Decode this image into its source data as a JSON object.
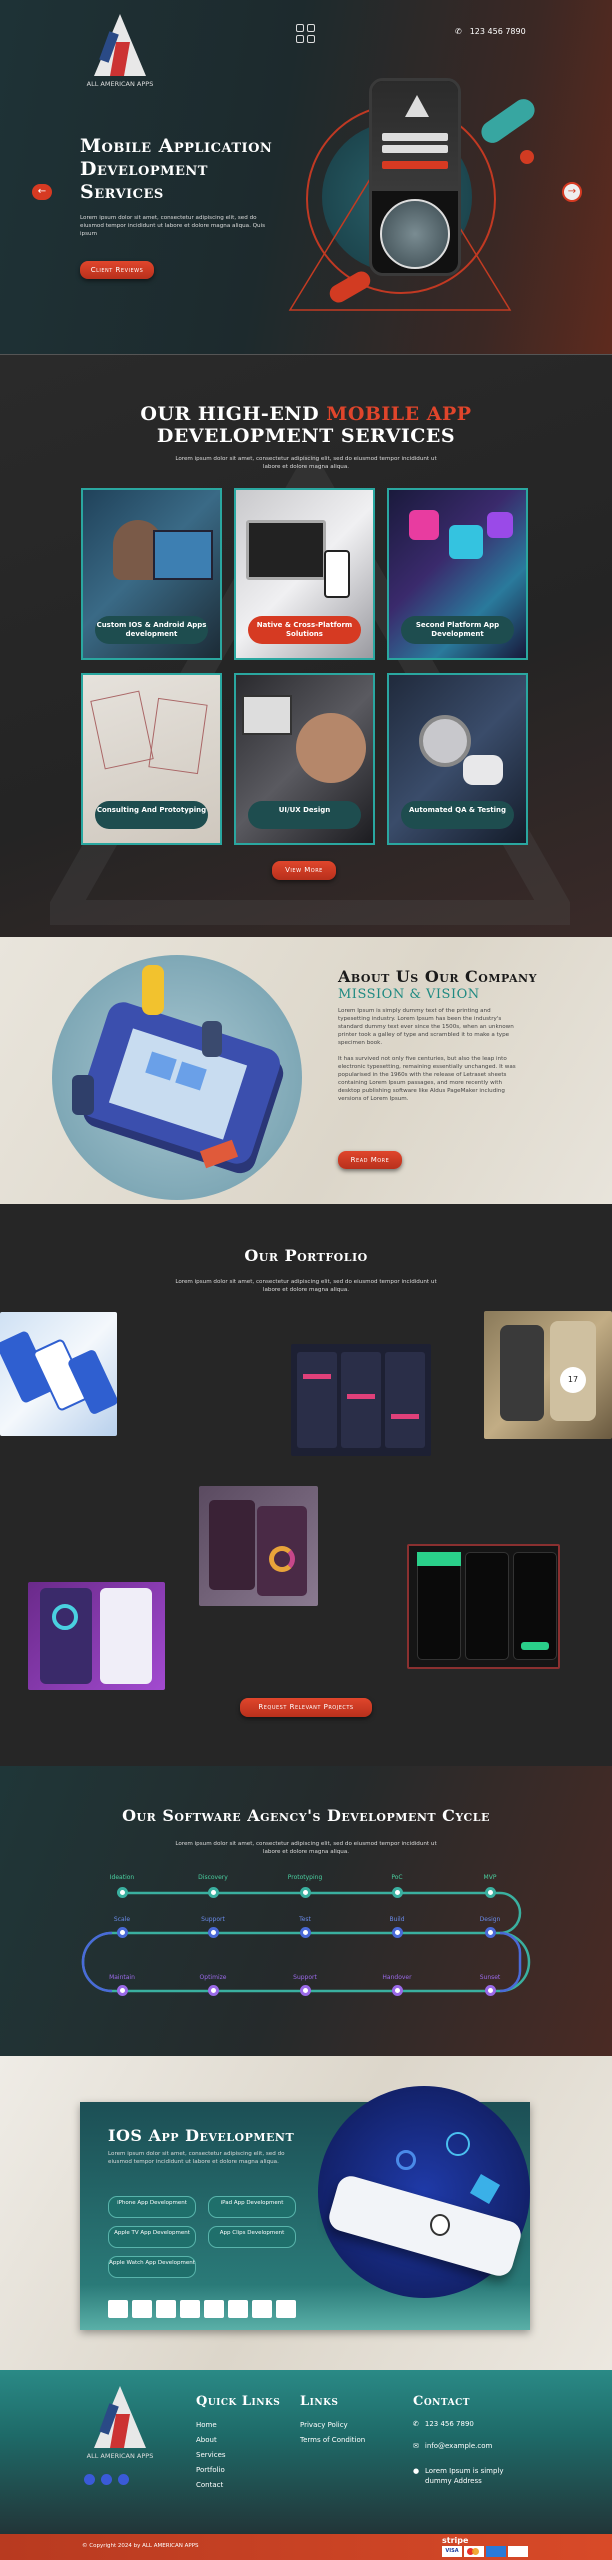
{
  "header": {
    "brand": "ALL AMERICAN APPS",
    "phone": "123 456 7890"
  },
  "hero": {
    "title_lines": [
      "Mobile Application",
      "Development",
      "Services"
    ],
    "text": "Lorem ipsum dolor sit amet, consectetur adipiscing elit, sed do eiusmod tempor incididunt ut labore et dolore magna aliqua. Quis ipsum",
    "cta": "Client Reviews"
  },
  "services": {
    "title_white": "OUR HIGH-END",
    "title_red": "MOBILE APP",
    "title_line2": "DEVELOPMENT SERVICES",
    "text": "Lorem ipsum dolor sit amet, consectetur adipiscing elit, sed do eiusmod tempor incididunt ut labore et dolore magna aliqua.",
    "cards": [
      {
        "label": "Custom IOS & Android Apps development"
      },
      {
        "label": "Native & Cross-Platform Solutions"
      },
      {
        "label": "Second Platform App Development"
      },
      {
        "label": "Consulting And Prototyping"
      },
      {
        "label": "UI/UX Design"
      },
      {
        "label": "Automated QA & Testing"
      }
    ],
    "cta": "View More"
  },
  "about": {
    "title": "About Us Our Company",
    "subtitle": "MISSION & VISION",
    "p1": "Lorem Ipsum is simply dummy text of the printing and typesetting industry. Lorem Ipsum has been the industry's standard dummy text ever since the 1500s, when an unknown printer took a galley of type and scrambled it to make a type specimen book.",
    "p2": "It has survived not only five centuries, but also the leap into electronic typesetting, remaining essentially unchanged. It was popularised in the 1960s with the release of Letraset sheets containing Lorem Ipsum passages, and more recently with desktop publishing software like Aldus PageMaker including versions of Lorem Ipsum.",
    "cta": "Read More"
  },
  "portfolio": {
    "title": "Our Portfolio",
    "text": "Lorem ipsum dolor sit amet, consectetur adipiscing elit, sed do eiusmod tempor incididunt ut labore et dolore magna aliqua.",
    "cta": "Request Relevant Projects"
  },
  "cycle": {
    "title": "Our Software Agency's Development Cycle",
    "text": "Lorem ipsum dolor sit amet, consectetur adipiscing elit, sed do eiusmod tempor incididunt ut labore et dolore magna aliqua.",
    "row1": [
      "Ideation",
      "Discovery",
      "Prototyping",
      "PoC",
      "MVP"
    ],
    "row2": [
      "Scale",
      "Support",
      "Test",
      "Build",
      "Design"
    ],
    "row3": [
      "Maintain",
      "Optimize",
      "Support",
      "Handover",
      "Sunset"
    ]
  },
  "ios": {
    "title": "IOS App Development",
    "text": "Lorem ipsum dolor sit amet, consectetur adipiscing elit, sed do eiusmod tempor incididunt ut labore et dolore magna aliqua.",
    "pills": [
      "iPhone App Development",
      "iPad App Development",
      "Apple TV App Development",
      "App Clips Development",
      "Apple Watch App Development"
    ]
  },
  "footer": {
    "brand": "ALL AMERICAN APPS",
    "quick_title": "Quick Links",
    "quick": [
      "Home",
      "About",
      "Services",
      "Portfolio",
      "Contact"
    ],
    "links_title": "Links",
    "links": [
      "Privacy Policy",
      "Terms of Condition"
    ],
    "contact_title": "Contact",
    "contact_phone": "123 456 7890",
    "contact_email": "info@example.com",
    "contact_address": "Lorem Ipsum is simply dummy Address",
    "copyright": "© Copyright 2024 by ALL AMERICAN APPS",
    "stripe": "stripe",
    "cards": [
      "VISA"
    ]
  },
  "colors": {
    "accent": "#d63a22",
    "teal": "#2a8f88",
    "dark": "#262626"
  }
}
